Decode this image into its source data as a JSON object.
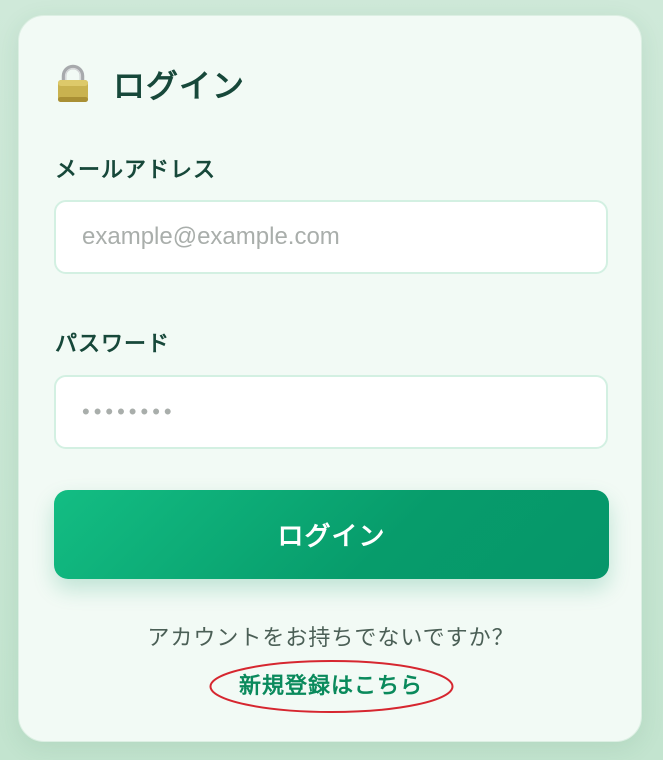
{
  "login_form": {
    "title": "ログイン",
    "title_icon": "padlock-icon",
    "email": {
      "label": "メールアドレス",
      "value": "",
      "placeholder": "example@example.com"
    },
    "password": {
      "label": "パスワード",
      "value": "",
      "placeholder": "••••••••"
    },
    "submit_label": "ログイン",
    "signup_prompt": "アカウントをお持ちでないですか？",
    "signup_link": "新規登録はこちら"
  },
  "colors": {
    "background": "#c8e6d2",
    "card": "#f2faf5",
    "heading": "#17483a",
    "button_start": "#13bd83",
    "button_end": "#06966a",
    "link": "#0a8a5c",
    "annotation_ellipse": "#d6262f"
  }
}
